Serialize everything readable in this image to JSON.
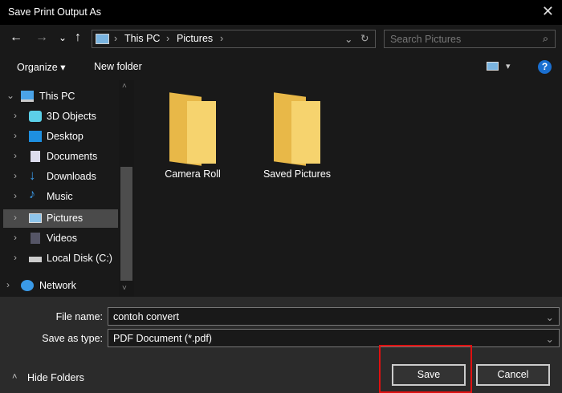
{
  "window": {
    "title": "Save Print Output As",
    "close": "✕"
  },
  "nav": {
    "back": "←",
    "forward": "→",
    "recent": "⌄",
    "up": "↑",
    "breadcrumb": [
      "This PC",
      "Pictures"
    ],
    "separator": "›",
    "search_placeholder": "Search Pictures"
  },
  "toolbar": {
    "organize": "Organize ▾",
    "new_folder": "New folder",
    "view": "▾",
    "help": "?"
  },
  "sidebar": {
    "items": [
      {
        "label": "This PC",
        "icon": "pc-icon"
      },
      {
        "label": "3D Objects",
        "icon": "cube-icon"
      },
      {
        "label": "Desktop",
        "icon": "desktop-icon"
      },
      {
        "label": "Documents",
        "icon": "documents-icon"
      },
      {
        "label": "Downloads",
        "icon": "download-icon"
      },
      {
        "label": "Music",
        "icon": "music-icon"
      },
      {
        "label": "Pictures",
        "icon": "pictures-icon",
        "selected": true
      },
      {
        "label": "Videos",
        "icon": "videos-icon"
      },
      {
        "label": "Local Disk (C:)",
        "icon": "disk-icon"
      },
      {
        "label": "Network",
        "icon": "network-icon"
      }
    ]
  },
  "folders": [
    {
      "label": "Camera Roll"
    },
    {
      "label": "Saved Pictures"
    }
  ],
  "form": {
    "file_name_label": "File name:",
    "file_name": "contoh convert",
    "type_label": "Save as type:",
    "type": "PDF Document (*.pdf)"
  },
  "footer": {
    "hide_folders": "Hide Folders",
    "save": "Save",
    "cancel": "Cancel"
  },
  "colors": {
    "highlight": "#e01010",
    "folder": "#f0c860"
  }
}
